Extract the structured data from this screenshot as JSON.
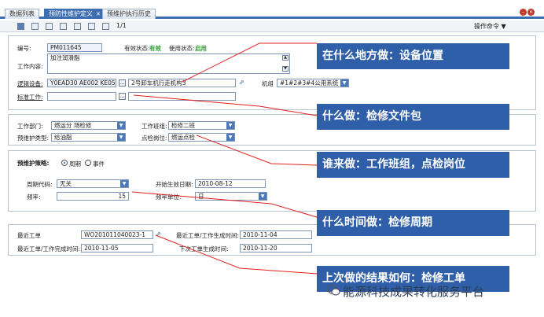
{
  "tabs": [
    {
      "label": "数据列表"
    },
    {
      "label": "预防性维护定义",
      "active": true
    },
    {
      "label": "预维护执行历史"
    }
  ],
  "toolbar": {
    "page_info": "1/1",
    "ops_menu": "操作命令 ▼"
  },
  "basic": {
    "code_label": "编号:",
    "code_value": "PM011645",
    "valid_label": "有效状态:",
    "valid_value": "有效",
    "use_label": "使用状态:",
    "use_value": "启用",
    "content_label": "工作内容:",
    "content_value": "加注润滑脂",
    "device_label": "逻辑设备:",
    "device_code": "Y0EAD30 AE002 KE05",
    "device_name": "2号卸车机行走机构3",
    "unit_label": "机组",
    "unit_value": "#1#2#3#4公用系统",
    "std_label": "标准工作:"
  },
  "org": {
    "dept_label": "工作部门:",
    "dept_value": "燃运分 场检修",
    "team_label": "工作班组:",
    "team_value": "检修二班",
    "type_label": "预维护类型:",
    "type_value": "给油脂",
    "post_label": "点检岗位:",
    "post_value": "燃运点检"
  },
  "strategy": {
    "title": "预维护策略:",
    "opt_period": "周期",
    "opt_event": "事件",
    "cycle_label": "周期代码:",
    "cycle_value": "无关",
    "start_label": "开始生效日期:",
    "start_value": "2010-08-12",
    "freq_label": "频率:",
    "freq_value": "15",
    "unit_label": "频率单位:",
    "unit_value": "日"
  },
  "history": {
    "last_wo_label": "最近工单",
    "last_wo_value": "WO201011040023-1",
    "last_gen_label": "最近工单/工作生成时间:",
    "last_gen_value": "2010-11-04",
    "last_done_label": "最近工单/工作完成时间:",
    "last_done_value": "2010-11-05",
    "next_gen_label": "下次工单生成时间:",
    "next_gen_value": "2010-11-20"
  },
  "callouts": [
    "在什么地方做：设备位置",
    "什么做：检修文件包",
    "谁来做：工作班组，点检岗位",
    "什么时间做：检修周期",
    "上次做的结果如何：检修工单"
  ],
  "watermark": "能源科技成果转化服务平台",
  "colors": {
    "accent": "#2f5fa8",
    "line": "#e02020",
    "valid": "#2e9e2e"
  }
}
